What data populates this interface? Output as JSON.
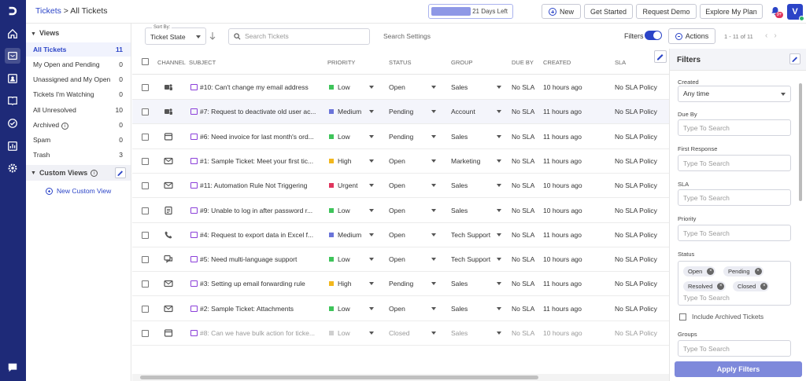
{
  "header": {
    "breadcrumb_link": "Tickets",
    "breadcrumb_sep": " > ",
    "breadcrumb_current": "All Tickets",
    "trial_label": "21 Days Left",
    "new_label": "New",
    "get_started_label": "Get Started",
    "request_demo_label": "Request Demo",
    "explore_plan_label": "Explore My Plan",
    "notification_count": "9+",
    "avatar_initial": "V"
  },
  "views": {
    "title": "Views",
    "items": [
      {
        "label": "All Tickets",
        "count": "11"
      },
      {
        "label": "My Open and Pending",
        "count": "0"
      },
      {
        "label": "Unassigned and My Open",
        "count": "0"
      },
      {
        "label": "Tickets I'm Watching",
        "count": "0"
      },
      {
        "label": "All Unresolved",
        "count": "10"
      },
      {
        "label": "Archived",
        "count": "0"
      },
      {
        "label": "Spam",
        "count": "0"
      },
      {
        "label": "Trash",
        "count": "3"
      }
    ],
    "custom_views_title": "Custom Views",
    "new_custom_view": "New Custom View"
  },
  "toolbar": {
    "sort_by_label": "Sort By:",
    "sort_value": "Ticket State",
    "search_placeholder": "Search Tickets",
    "search_settings": "Search Settings",
    "filters_label": "Filters",
    "actions_label": "Actions",
    "pager": "1 - 11 of 11"
  },
  "table": {
    "columns": [
      "CHANNEL",
      "SUBJECT",
      "PRIORITY",
      "STATUS",
      "GROUP",
      "DUE BY",
      "CREATED",
      "SLA"
    ],
    "rows": [
      {
        "channel": "teams",
        "subject": "#10: Can't change my email address",
        "priority": "Low",
        "status": "Open",
        "group": "Sales",
        "due": "No SLA",
        "created": "10 hours ago",
        "sla": "No SLA Policy"
      },
      {
        "channel": "teams",
        "subject": "#7: Request to deactivate old user ac...",
        "priority": "Medium",
        "status": "Pending",
        "group": "Account",
        "due": "No SLA",
        "created": "11 hours ago",
        "sla": "No SLA Policy"
      },
      {
        "channel": "widget",
        "subject": "#6: Need invoice for last month's ord...",
        "priority": "Low",
        "status": "Pending",
        "group": "Sales",
        "due": "No SLA",
        "created": "11 hours ago",
        "sla": "No SLA Policy"
      },
      {
        "channel": "email",
        "subject": "#1: Sample Ticket: Meet your first tic...",
        "priority": "High",
        "status": "Open",
        "group": "Marketing",
        "due": "No SLA",
        "created": "11 hours ago",
        "sla": "No SLA Policy"
      },
      {
        "channel": "email",
        "subject": "#11: Automation Rule Not Triggering",
        "priority": "Urgent",
        "status": "Open",
        "group": "Sales",
        "due": "No SLA",
        "created": "10 hours ago",
        "sla": "No SLA Policy"
      },
      {
        "channel": "form",
        "subject": "#9: Unable to log in after password r...",
        "priority": "Low",
        "status": "Open",
        "group": "Sales",
        "due": "No SLA",
        "created": "10 hours ago",
        "sla": "No SLA Policy"
      },
      {
        "channel": "phone",
        "subject": "#4: Request to export data in Excel f...",
        "priority": "Medium",
        "status": "Open",
        "group": "Tech Support",
        "due": "No SLA",
        "created": "11 hours ago",
        "sla": "No SLA Policy"
      },
      {
        "channel": "chat",
        "subject": "#5: Need multi-language support",
        "priority": "Low",
        "status": "Open",
        "group": "Tech Support",
        "due": "No SLA",
        "created": "10 hours ago",
        "sla": "No SLA Policy"
      },
      {
        "channel": "email",
        "subject": "#3: Setting up email forwarding rule",
        "priority": "High",
        "status": "Pending",
        "group": "Sales",
        "due": "No SLA",
        "created": "11 hours ago",
        "sla": "No SLA Policy"
      },
      {
        "channel": "email",
        "subject": "#2: Sample Ticket: Attachments",
        "priority": "Low",
        "status": "Open",
        "group": "Sales",
        "due": "No SLA",
        "created": "11 hours ago",
        "sla": "No SLA Policy"
      },
      {
        "channel": "widget",
        "subject": "#8: Can we have bulk action for ticke...",
        "priority": "Low",
        "status": "Closed",
        "group": "Sales",
        "due": "No SLA",
        "created": "10 hours ago",
        "sla": "No SLA Policy"
      }
    ]
  },
  "colors": {
    "Low": "#3ec45a",
    "Medium": "#6a74d9",
    "High": "#f2b71d",
    "Urgent": "#e0355d",
    "primary": "#2b44c7",
    "rail": "#1e2a78"
  },
  "filters": {
    "title": "Filters",
    "created_label": "Created",
    "created_value": "Any time",
    "due_by_label": "Due By",
    "first_response_label": "First Response",
    "sla_label": "SLA",
    "priority_label": "Priority",
    "status_label": "Status",
    "status_chips": [
      "Open",
      "Pending",
      "Resolved",
      "Closed"
    ],
    "include_archived_label": "Include Archived Tickets",
    "groups_label": "Groups",
    "type_to_search": "Type To Search",
    "apply_label": "Apply Filters"
  }
}
